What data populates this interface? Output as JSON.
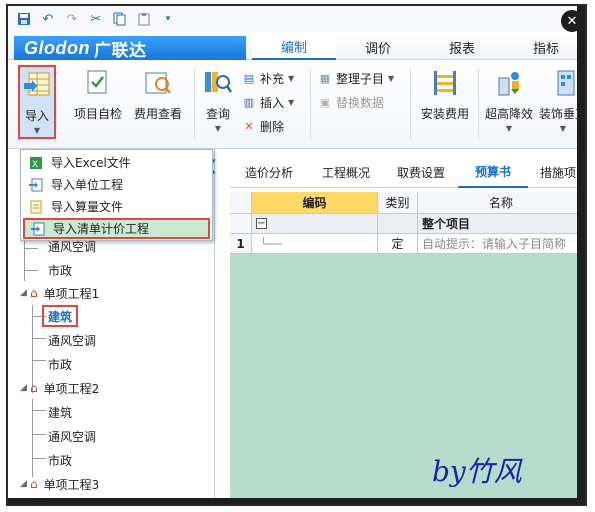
{
  "app": {
    "logo_text": "Glodon",
    "logo_cn": "广联达"
  },
  "menu_tabs": [
    {
      "label": "编制",
      "active": true
    },
    {
      "label": "调价",
      "active": false
    },
    {
      "label": "报表",
      "active": false
    },
    {
      "label": "指标",
      "active": false
    }
  ],
  "ribbon": {
    "import_label": "导入",
    "project_check_label": "项目自检",
    "fee_view_label": "费用查看",
    "query_label": "查询",
    "supplement_label": "补充",
    "insert_label": "插入",
    "delete_label": "删除",
    "organize_label": "整理子目",
    "replace_data_label": "替换数据",
    "install_fee_label": "安装费用",
    "super_high_label": "超高降效",
    "decoration_label": "装饰垂直"
  },
  "import_menu": {
    "items": [
      {
        "label": "导入Excel文件",
        "selected": false
      },
      {
        "label": "导入单位工程",
        "selected": false
      },
      {
        "label": "导入算量文件",
        "selected": false
      },
      {
        "label": "导入清单计价工程",
        "selected": true
      }
    ]
  },
  "tree": {
    "rows": [
      {
        "label": "通风空调"
      },
      {
        "label": "市政"
      },
      {
        "label": "单项工程1"
      },
      {
        "label": "建筑"
      },
      {
        "label": "通风空调"
      },
      {
        "label": "市政"
      },
      {
        "label": "单项工程2"
      },
      {
        "label": "建筑"
      },
      {
        "label": "通风空调"
      },
      {
        "label": "市政"
      },
      {
        "label": "单项工程3"
      }
    ]
  },
  "subtabs": [
    {
      "label": "造价分析",
      "active": false
    },
    {
      "label": "工程概况",
      "active": false
    },
    {
      "label": "取费设置",
      "active": false
    },
    {
      "label": "预算书",
      "active": true
    },
    {
      "label": "措施项",
      "active": false
    }
  ],
  "grid": {
    "headers": {
      "code": "编码",
      "category": "类别",
      "name": "名称"
    },
    "summary_row": {
      "name": "整个项目"
    },
    "rows": [
      {
        "num": "1",
        "code": "",
        "category": "定",
        "name": "自动提示：请输入子目简称"
      }
    ]
  },
  "signature": "by竹风",
  "colors": {
    "accent": "#1a6fd1",
    "highlight_border": "#e2473f",
    "grid_bg": "#b6dccb",
    "header_highlight": "#ffd966"
  }
}
